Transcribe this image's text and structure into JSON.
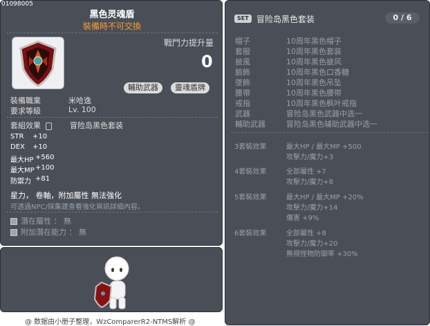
{
  "item": {
    "id": "01098005",
    "name": "黑色灵魂盾",
    "untradeable": "裝備時不可交換",
    "power_label": "戰鬥力提升量",
    "power_value": "0",
    "tags": [
      "輔助武器",
      "靈魂盾牌"
    ],
    "job_label": "裝備職業",
    "job_value": "米哈逸",
    "level_label": "要求等級",
    "level_value": "Lv. 100",
    "set_label": "套組效果",
    "set_value": "冒险岛黑色套装",
    "stats": [
      {
        "label": "STR",
        "value": "+10"
      },
      {
        "label": "DEX",
        "value": "+10"
      },
      {
        "label": "最大HP",
        "value": "+560"
      },
      {
        "label": "最大MP",
        "value": "+100"
      },
      {
        "label": "防禦力",
        "value": "+81"
      }
    ],
    "desc_main": "星力， 卷軸，附加屬性 無法強化",
    "desc_sub": "可透過NPC/採集建查看強化資訊詳細內容。",
    "potential_label": "潛在屬性 ： 無",
    "bonus_potential_label": "附加潛在能力 ： 無"
  },
  "set": {
    "badge": "SET",
    "name": "冒险岛黑色套装",
    "count": "0 / 6",
    "parts": [
      {
        "slot": "帽子",
        "name": "10周年黑色帽子"
      },
      {
        "slot": "套服",
        "name": "10周年黑色套装"
      },
      {
        "slot": "披風",
        "name": "10周年黑色披风"
      },
      {
        "slot": "臉飾",
        "name": "10周年黑色口香糖"
      },
      {
        "slot": "墜飾",
        "name": "10周年黑色吊坠"
      },
      {
        "slot": "腰帶",
        "name": "10周年黑色腰带"
      },
      {
        "slot": "戒指",
        "name": "10周年黑色枫叶戒指"
      },
      {
        "slot": "武器",
        "name": "冒险岛黑色武器中选一"
      },
      {
        "slot": "輔助武器",
        "name": "冒险岛黑色辅助武器中选一"
      }
    ],
    "bonuses": [
      {
        "title": "3套裝效果",
        "lines": [
          "最大HP / 最大MP  +500",
          "攻擊力/魔力+3"
        ]
      },
      {
        "title": "4套裝效果",
        "lines": [
          "全部屬性 +7",
          "攻擊力/魔力+8"
        ]
      },
      {
        "title": "5套裝效果",
        "lines": [
          "最大HP / 最大MP  +20%",
          "攻擊力/魔力+14",
          "傷害  +9%"
        ]
      },
      {
        "title": "6套裝效果",
        "lines": [
          "全部屬性 +8",
          "攻擊力/魔力+20",
          "無視怪物防御率  +30%"
        ]
      }
    ]
  },
  "footer": "@ 数据由小册子整理，WzComparerR2-NTMS解析 @"
}
